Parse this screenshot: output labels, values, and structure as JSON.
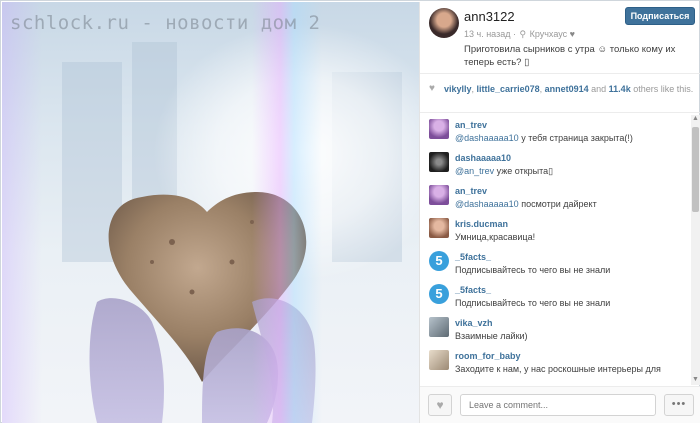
{
  "watermark": "schlock.ru - новости дом 2",
  "post": {
    "username": "ann3122",
    "follow_label": "Подписаться",
    "time": "13 ч. назад",
    "location": "Кручхаус",
    "caption": "Приготовила сырников с утра ☺ только кому их теперь есть? ▯"
  },
  "likes": {
    "users": [
      "vikylly",
      "little_carrie078",
      "annet0914"
    ],
    "sep1": ", ",
    "sep2": ", ",
    "and_label": " and ",
    "count": "11.4k",
    "rest": " others like this."
  },
  "comments": [
    {
      "author": "an_trev",
      "mention": "@dashaaaaa10",
      "text": " у тебя страница закрыта(!)",
      "avatar": "purple"
    },
    {
      "author": "dashaaaaa10",
      "mention": "@an_trev",
      "text": " уже открыта▯",
      "avatar": "dark"
    },
    {
      "author": "an_trev",
      "mention": "@dashaaaaa10",
      "text": " посмотри дайрект",
      "avatar": "purple"
    },
    {
      "author": "kris.ducman",
      "mention": "",
      "text": "Умница,красавица!",
      "avatar": "warm"
    },
    {
      "author": "_5facts_",
      "mention": "",
      "text": "Подписывайтесь то чего вы не знали",
      "avatar": "five"
    },
    {
      "author": "_5facts_",
      "mention": "",
      "text": "Подписывайтесь то чего вы не знали",
      "avatar": "five"
    },
    {
      "author": "vika_vzh",
      "mention": "",
      "text": "Взаимные лайки)",
      "avatar": "gray"
    },
    {
      "author": "room_for_baby",
      "mention": "",
      "text": "Заходите к нам, у нас роскошные интерьеры для",
      "avatar": "room"
    }
  ],
  "five_glyph": "5",
  "comment_placeholder": "Leave a comment...",
  "more_label": "•••",
  "heart_glyph": "♥",
  "icons": [
    "heart-icon",
    "pin-icon",
    "ellipsis-icon",
    "scroll-arrow-icon"
  ],
  "colors": {
    "accent": "#3f729b",
    "five": "#39a0dc"
  }
}
